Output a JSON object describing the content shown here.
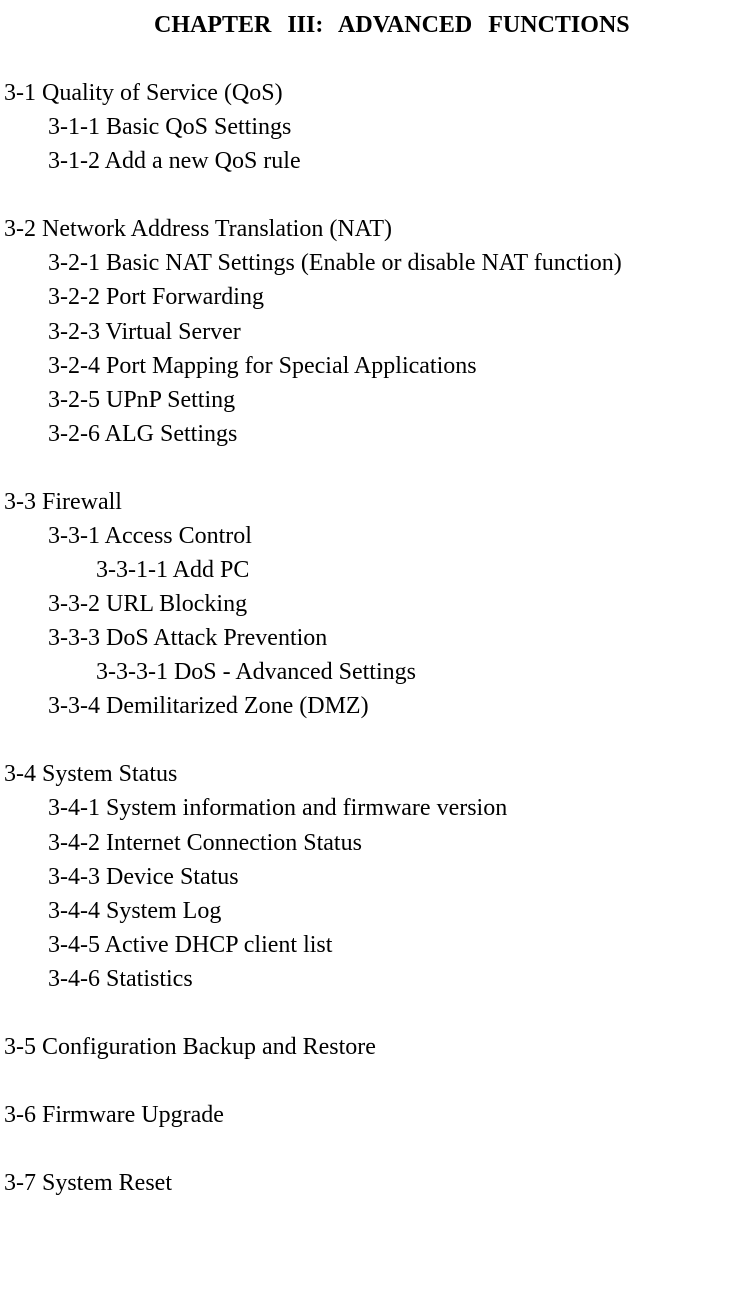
{
  "title": "CHAPTER III:    ADVANCED FUNCTIONS",
  "sections": [
    {
      "heading": "3-1 Quality of Service (QoS)",
      "items": [
        {
          "text": "3-1-1 Basic QoS Settings",
          "level": 1
        },
        {
          "text": "3-1-2 Add a new QoS rule",
          "level": 1
        }
      ]
    },
    {
      "heading": "3-2 Network Address Translation (NAT)",
      "items": [
        {
          "text": "3-2-1 Basic NAT Settings (Enable or disable NAT function)",
          "level": 1
        },
        {
          "text": "3-2-2 Port Forwarding",
          "level": 1
        },
        {
          "text": "3-2-3 Virtual Server",
          "level": 1
        },
        {
          "text": "3-2-4 Port Mapping for Special Applications",
          "level": 1
        },
        {
          "text": "3-2-5 UPnP Setting",
          "level": 1
        },
        {
          "text": "3-2-6 ALG Settings",
          "level": 1
        }
      ]
    },
    {
      "heading": "3-3 Firewall",
      "items": [
        {
          "text": "3-3-1 Access Control",
          "level": 1
        },
        {
          "text": "3-3-1-1 Add PC",
          "level": 2
        },
        {
          "text": "3-3-2 URL Blocking",
          "level": 1
        },
        {
          "text": "3-3-3 DoS Attack Prevention",
          "level": 1
        },
        {
          "text": "3-3-3-1 DoS - Advanced Settings",
          "level": 2
        },
        {
          "text": "3-3-4 Demilitarized Zone (DMZ)",
          "level": 1
        }
      ]
    },
    {
      "heading": "3-4 System Status",
      "items": [
        {
          "text": "3-4-1 System information and firmware version",
          "level": 1
        },
        {
          "text": "3-4-2 Internet Connection Status",
          "level": 1
        },
        {
          "text": "3-4-3 Device Status",
          "level": 1
        },
        {
          "text": "3-4-4 System Log",
          "level": 1
        },
        {
          "text": "3-4-5 Active DHCP client list",
          "level": 1
        },
        {
          "text": "3-4-6 Statistics",
          "level": 1
        }
      ]
    },
    {
      "heading": "3-5 Configuration Backup and Restore",
      "items": []
    },
    {
      "heading": "3-6 Firmware Upgrade",
      "items": []
    },
    {
      "heading": "3-7 System Reset",
      "items": []
    }
  ]
}
